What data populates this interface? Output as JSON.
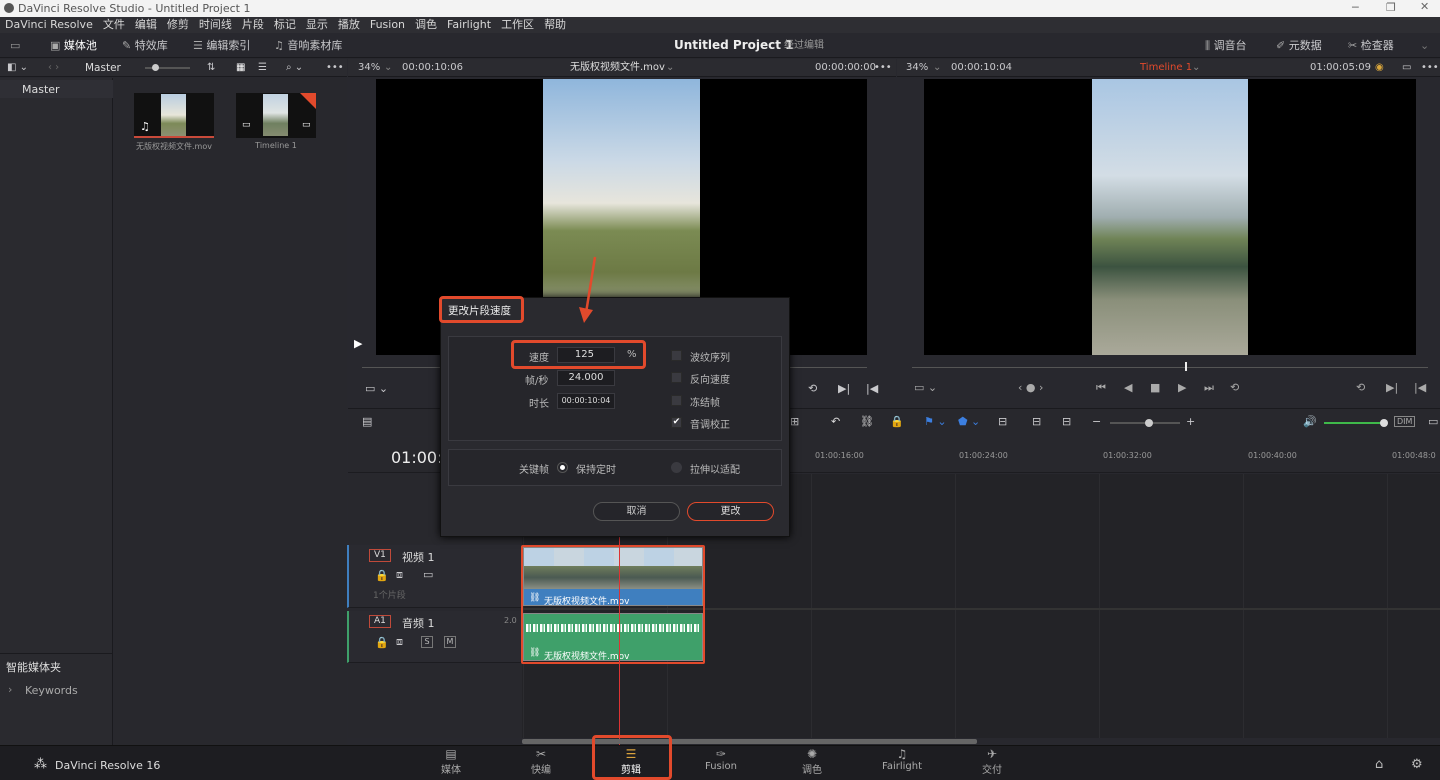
{
  "window": {
    "title": "DaVinci Resolve Studio - Untitled Project 1"
  },
  "menu": [
    "DaVinci Resolve",
    "文件",
    "编辑",
    "修剪",
    "时间线",
    "片段",
    "标记",
    "显示",
    "播放",
    "Fusion",
    "调色",
    "Fairlight",
    "工作区",
    "帮助"
  ],
  "toolbar": {
    "media_pool": "媒体池",
    "effects": "特效库",
    "edit_index": "编辑索引",
    "sound_library": "音响素材库",
    "project_title": "Untitled Project 1",
    "project_sub": "经过编辑",
    "mixer": "调音台",
    "metadata": "元数据",
    "inspector": "检查器"
  },
  "bin": {
    "name": "Master",
    "tree_item": "Master",
    "smart_bins": "智能媒体夹",
    "keywords": "Keywords",
    "clips": [
      {
        "name": "无版权视频文件.mov"
      },
      {
        "name": "Timeline 1"
      }
    ]
  },
  "source_viewer": {
    "zoom": "34%",
    "duration": "00:00:10:06",
    "clip_name": "无版权视频文件.mov",
    "timecode": "00:00:00:00"
  },
  "timeline_viewer": {
    "zoom": "34%",
    "duration": "00:00:10:04",
    "timeline_name": "Timeline 1",
    "timecode": "01:00:05:09"
  },
  "timeline": {
    "current_tc": "01:00:0",
    "ruler": [
      "01:00:16:00",
      "01:00:24:00",
      "01:00:32:00",
      "01:00:40:00",
      "01:00:48:0"
    ],
    "tracks": {
      "v1": {
        "id": "V1",
        "name": "视频 1",
        "clips_count": "1个片段"
      },
      "a1": {
        "id": "A1",
        "name": "音频 1",
        "channels": "2.0"
      }
    },
    "clip_name": "无版权视频文件.mov",
    "dim": "DIM"
  },
  "dialog": {
    "title": "更改片段速度",
    "speed_label": "速度",
    "speed_value": "125",
    "speed_unit": "%",
    "fps_label": "帧/秒",
    "fps_value": "24.000",
    "duration_label": "时长",
    "duration_value": "00:00:10:04",
    "ripple": "波纹序列",
    "reverse": "反向速度",
    "freeze": "冻结帧",
    "pitch": "音调校正",
    "pitch_checked": true,
    "keyframe_label": "关键帧",
    "keep_timing": "保持定时",
    "stretch_fit": "拉伸以适配",
    "cancel": "取消",
    "change": "更改"
  },
  "pages": [
    {
      "label": "媒体",
      "icon": "media-icon"
    },
    {
      "label": "快编",
      "icon": "cut-icon"
    },
    {
      "label": "剪辑",
      "icon": "edit-icon",
      "active": true
    },
    {
      "label": "Fusion",
      "icon": "fusion-icon"
    },
    {
      "label": "调色",
      "icon": "color-icon"
    },
    {
      "label": "Fairlight",
      "icon": "fairlight-icon"
    },
    {
      "label": "交付",
      "icon": "deliver-icon"
    }
  ],
  "footer": {
    "app": "DaVinci Resolve 16"
  },
  "colors": {
    "accent_red": "#e24a2c",
    "video_clip": "#3f7fbf",
    "audio_clip": "#3fa06a",
    "timeline_name": "#e24a2c"
  }
}
